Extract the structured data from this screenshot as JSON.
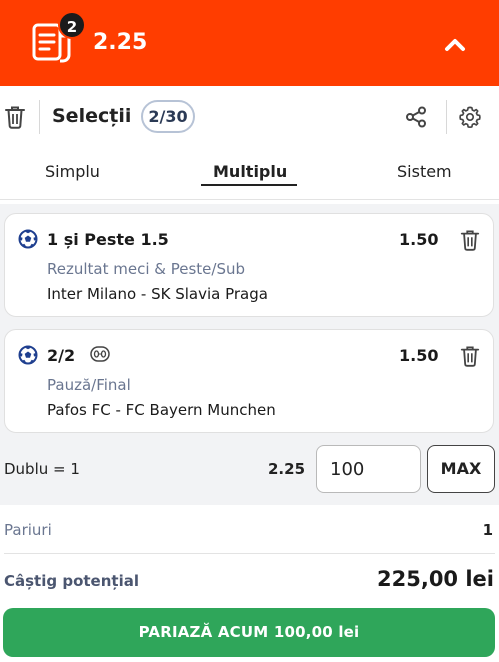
{
  "header": {
    "selections_count": "2",
    "total_odds": "2.25"
  },
  "toolbar": {
    "title": "Selecții",
    "badge": "2/30"
  },
  "tabs": [
    {
      "label": "Simplu",
      "active": false
    },
    {
      "label": "Multiplu",
      "active": true
    },
    {
      "label": "Sistem",
      "active": false
    }
  ],
  "selections": [
    {
      "pick": "1 și Peste 1.5",
      "odds": "1.50",
      "market": "Rezultat meci & Peste/Sub",
      "match": "Inter Milano - SK Slavia Praga",
      "icon": "soccer-ball-icon"
    },
    {
      "pick": "2/2",
      "odds": "1.50",
      "market": "Pauză/Final",
      "match": "Pafos FC - FC Bayern Munchen",
      "icon": "soccer-ball-icon",
      "extra_icon": "score-0-0-icon"
    }
  ],
  "combo": {
    "label": "Dublu = 1",
    "odds": "2.25",
    "stake_value": "100",
    "max_label": "MAX"
  },
  "summary": {
    "bets_label": "Pariuri",
    "bets_value": "1",
    "win_label": "Câștig potențial",
    "win_value": "225,00 lei"
  },
  "cta": {
    "label": "PARIAZĂ ACUM 100,00 lei"
  },
  "colors": {
    "brand": "#ff3d00",
    "cta": "#2fa65a",
    "ball": "#1f3f8f"
  }
}
